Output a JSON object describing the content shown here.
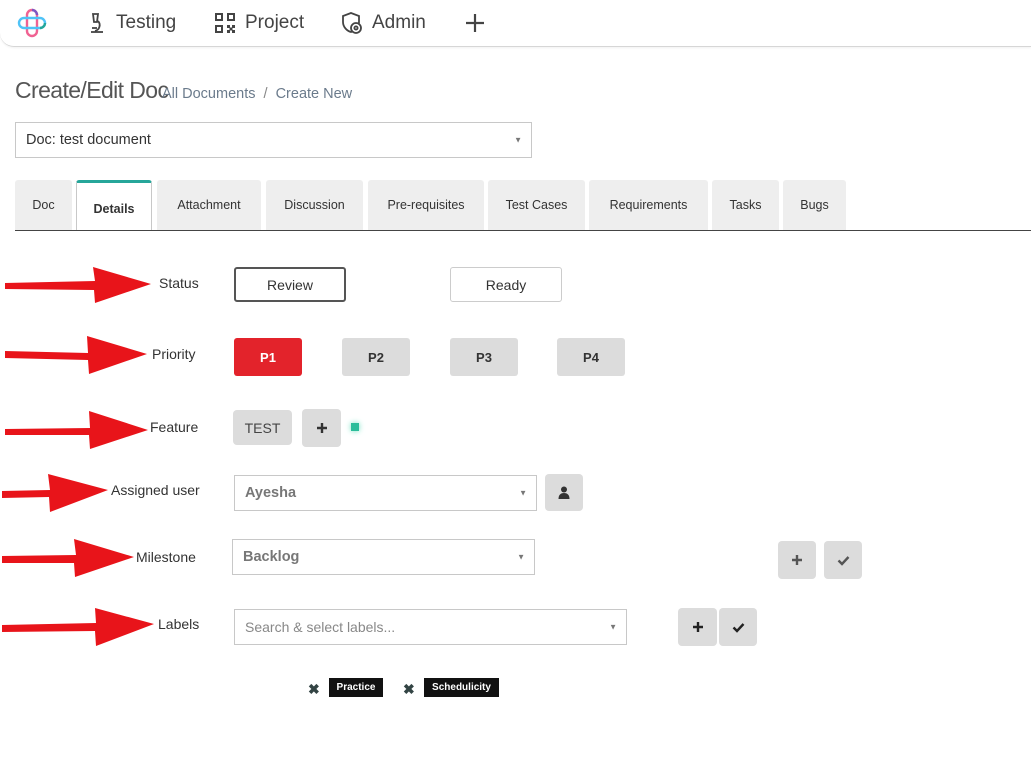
{
  "nav": {
    "items": [
      {
        "label": "Testing",
        "icon": "microscope-icon"
      },
      {
        "label": "Project",
        "icon": "qr-code-icon"
      },
      {
        "label": "Admin",
        "icon": "shield-gear-icon"
      }
    ]
  },
  "page": {
    "title": "Create/Edit Doc",
    "breadcrumb": [
      "All Documents",
      "/",
      "Create New"
    ]
  },
  "doc_select": {
    "value": "Doc: test document"
  },
  "tabs": [
    {
      "label": "Doc",
      "active": false
    },
    {
      "label": "Details",
      "active": true
    },
    {
      "label": "Attachment",
      "active": false
    },
    {
      "label": "Discussion",
      "active": false
    },
    {
      "label": "Pre-requisites",
      "active": false
    },
    {
      "label": "Test Cases",
      "active": false
    },
    {
      "label": "Requirements",
      "active": false
    },
    {
      "label": "Tasks",
      "active": false
    },
    {
      "label": "Bugs",
      "active": false
    }
  ],
  "form": {
    "status": {
      "label": "Status",
      "options": [
        "Review",
        "Ready"
      ],
      "selected": "Review"
    },
    "priority": {
      "label": "Priority",
      "options": [
        "P1",
        "P2",
        "P3",
        "P4"
      ],
      "selected": "P1"
    },
    "feature": {
      "label": "Feature",
      "chips": [
        "TEST"
      ]
    },
    "assigned_user": {
      "label": "Assigned user",
      "value": "Ayesha"
    },
    "milestone": {
      "label": "Milestone",
      "value": "Backlog"
    },
    "labels": {
      "label": "Labels",
      "placeholder": "Search & select labels...",
      "tags": [
        "Practice",
        "Schedulicity"
      ]
    }
  },
  "colors": {
    "accent": "#26a69a",
    "priority_selected": "#e3232b",
    "arrow": "#e8141a"
  }
}
